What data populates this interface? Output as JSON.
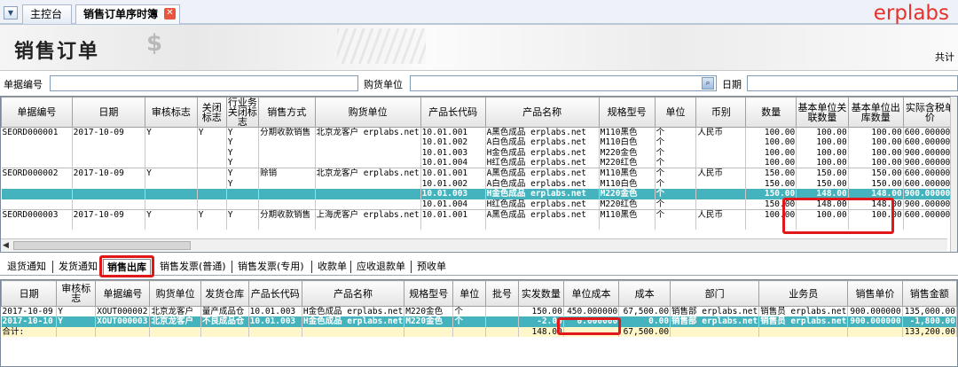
{
  "tabs": {
    "home": "主控台",
    "current": "销售订单序时簿"
  },
  "brand": "erplabs",
  "banner": {
    "title": "销售订单",
    "total_prefix": "共计"
  },
  "filter": {
    "order_no_label": "单据编号",
    "customer_label": "购货单位",
    "date_label": "日期",
    "order_no_value": "",
    "customer_value": "",
    "date_value": ""
  },
  "main_grid": {
    "headers": [
      "单据编号",
      "日期",
      "审核标志",
      "关闭标志",
      "行业务关闭标志",
      "销售方式",
      "购货单位",
      "产品长代码",
      "产品名称",
      "规格型号",
      "单位",
      "币别",
      "数量",
      "基本单位关联数量",
      "基本单位出库数量",
      "实际含税单价"
    ],
    "rows": [
      [
        "SEORD000001",
        "2017-10-09",
        "Y",
        "Y",
        "Y",
        "分期收款销售",
        "北京龙客户 erplabs.net",
        "10.01.001",
        "A黑色成品 erplabs.net",
        "M110黑色",
        "个",
        "人民币",
        "100.00",
        "100.00",
        "100.00",
        "600.000000"
      ],
      [
        "",
        "",
        "",
        "",
        "Y",
        "",
        "",
        "10.01.002",
        "A白色成品 erplabs.net",
        "M110白色",
        "个",
        "",
        "100.00",
        "100.00",
        "100.00",
        "600.000000"
      ],
      [
        "",
        "",
        "",
        "",
        "Y",
        "",
        "",
        "10.01.003",
        "H金色成品 erplabs.net",
        "M220金色",
        "个",
        "",
        "100.00",
        "100.00",
        "100.00",
        "900.000000"
      ],
      [
        "",
        "",
        "",
        "",
        "Y",
        "",
        "",
        "10.01.004",
        "H红色成品 erplabs.net",
        "M220红色",
        "个",
        "",
        "100.00",
        "100.00",
        "100.00",
        "900.000000"
      ],
      [
        "SEORD000002",
        "2017-10-09",
        "Y",
        "",
        "Y",
        "赊销",
        "北京龙客户 erplabs.net",
        "10.01.001",
        "A黑色成品 erplabs.net",
        "M110黑色",
        "个",
        "人民币",
        "150.00",
        "150.00",
        "150.00",
        "600.000000"
      ],
      [
        "",
        "",
        "",
        "",
        "Y",
        "",
        "",
        "10.01.002",
        "A白色成品 erplabs.net",
        "M110白色",
        "个",
        "",
        "150.00",
        "150.00",
        "150.00",
        "600.000000"
      ],
      [
        "",
        "",
        "",
        "",
        "",
        "",
        "",
        "10.01.003",
        "H金色成品 erplabs.net",
        "M220金色",
        "个",
        "",
        "150.00",
        "148.00",
        "148.00",
        "900.000000"
      ],
      [
        "",
        "",
        "",
        "",
        "",
        "",
        "",
        "10.01.004",
        "H红色成品 erplabs.net",
        "M220红色",
        "个",
        "",
        "150.00",
        "148.00",
        "148.00",
        "900.000000"
      ],
      [
        "SEORD000003",
        "2017-10-09",
        "Y",
        "Y",
        "Y",
        "分期收款销售",
        "上海虎客户 erplabs.net",
        "10.01.001",
        "A黑色成品 erplabs.net",
        "M110黑色",
        "个",
        "人民币",
        "100.00",
        "100.00",
        "100.00",
        "600.000000"
      ]
    ]
  },
  "subtabs": [
    "退货通知",
    "发货通知",
    "销售出库",
    "销售发票(普通)",
    "销售发票(专用)",
    "收款单",
    "应收退款单",
    "预收单"
  ],
  "sub_grid": {
    "headers": [
      "日期",
      "审核标志",
      "单据编号",
      "购货单位",
      "发货仓库",
      "产品长代码",
      "产品名称",
      "规格型号",
      "单位",
      "批号",
      "实发数量",
      "单位成本",
      "成本",
      "部门",
      "业务员",
      "销售单价",
      "销售金额"
    ],
    "rows": [
      [
        "2017-10-09",
        "Y",
        "XOUT000002",
        "北京龙客户",
        "量产成品仓",
        "10.01.003",
        "H金色成品 erplabs.net",
        "M220金色",
        "个",
        "",
        "150.00",
        "450.000000",
        "67,500.00",
        "销售部 erplabs.net",
        "销售员 erplabs.net",
        "900.000000",
        "135,000.00"
      ],
      [
        "2017-10-10",
        "Y",
        "XOUT000003",
        "北京龙客户",
        "不良成品仓",
        "10.01.003",
        "H金色成品 erplabs.net",
        "M220金色",
        "个",
        "",
        "-2.00",
        "0.000000",
        "0.00",
        "销售部 erplabs.net",
        "销售员 erplabs.net",
        "900.000000",
        "-1,800.00"
      ]
    ],
    "total": [
      "合计:",
      "",
      "",
      "",
      "",
      "",
      "",
      "",
      "",
      "",
      "148.00",
      "",
      "67,500.00",
      "",
      "",
      "",
      "133,200.00"
    ]
  },
  "colors": {
    "highlight": "#44b3bd",
    "annotation": "#e0181a",
    "brand": "#e6322a",
    "sum_row": "#fff7c9"
  }
}
